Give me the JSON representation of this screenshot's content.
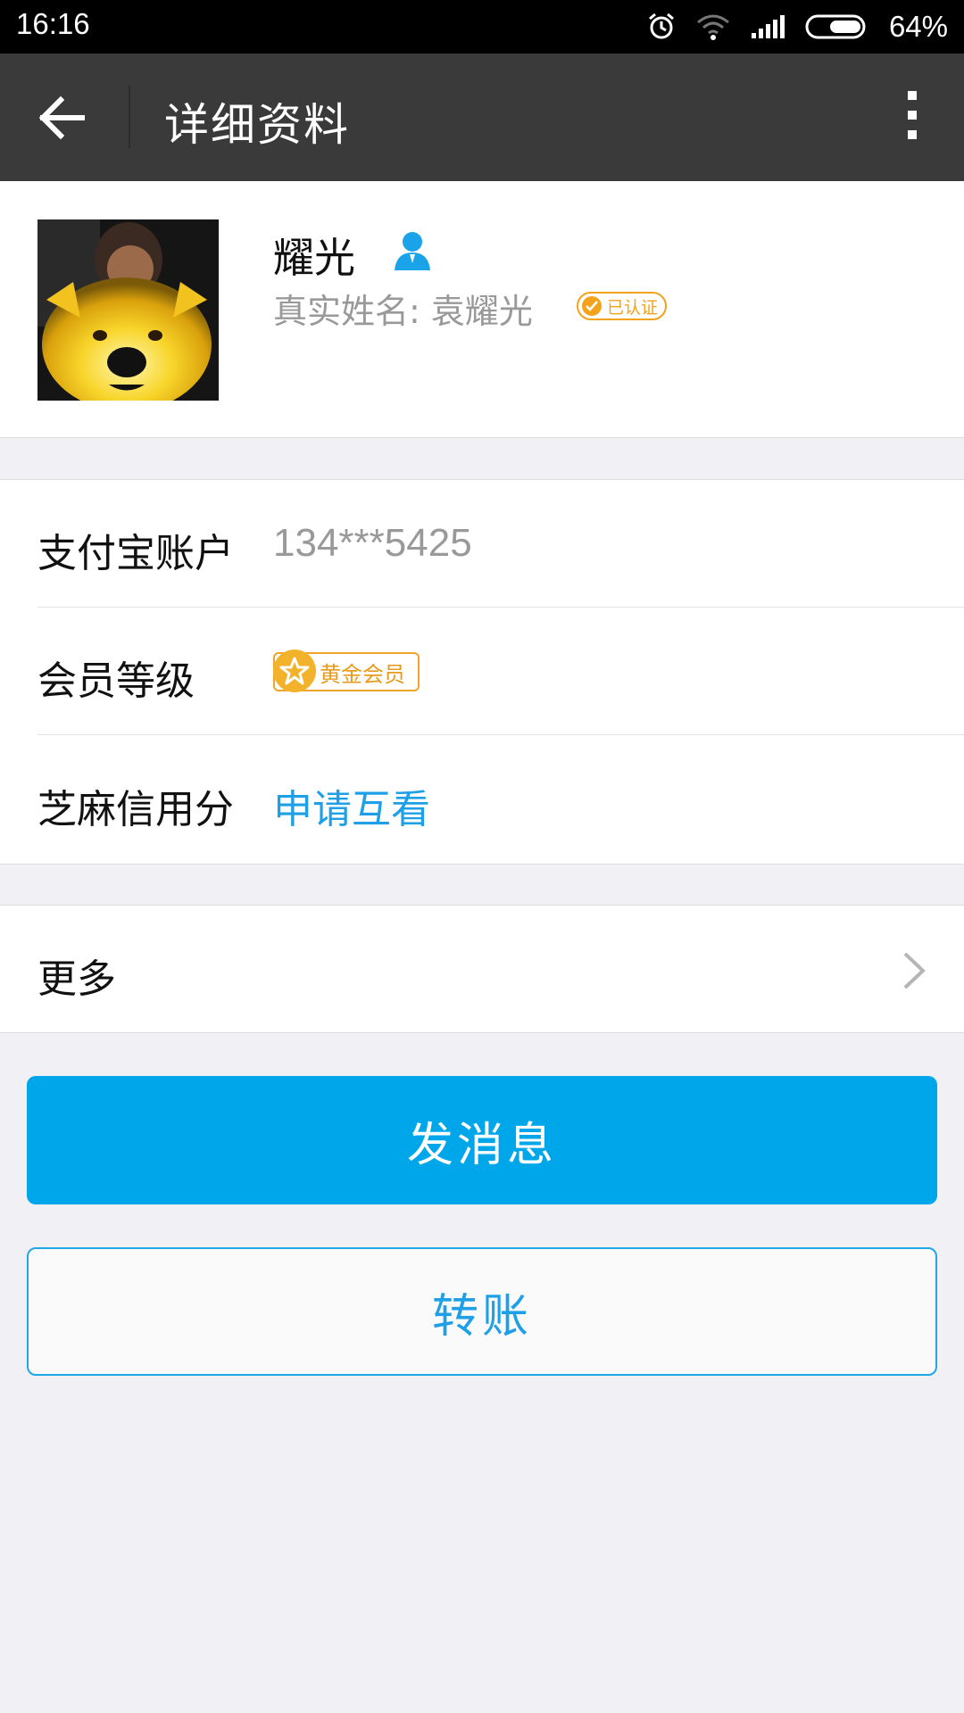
{
  "status_bar": {
    "time": "16:16",
    "battery_percent": "64%",
    "icons": [
      "alarm-icon",
      "wifi-icon",
      "signal-icon",
      "battery-icon"
    ]
  },
  "app_bar": {
    "title": "详细资料",
    "back_icon": "back-arrow-icon",
    "more_icon": "overflow-menu-icon"
  },
  "profile": {
    "nickname": "耀光",
    "real_name_label": "真实姓名: 袁耀光",
    "verified_label": "已认证"
  },
  "info": {
    "account_label": "支付宝账户",
    "account_value": "134***5425",
    "member_label": "会员等级",
    "member_badge": "黄金会员",
    "credit_label": "芝麻信用分",
    "credit_action": "申请互看"
  },
  "more": {
    "label": "更多"
  },
  "actions": {
    "send_message": "发消息",
    "transfer": "转账"
  },
  "colors": {
    "primary": "#00a6ea",
    "link": "#1fa0e6",
    "appbar": "#3a3a3a",
    "gold": "#f3a21c"
  }
}
